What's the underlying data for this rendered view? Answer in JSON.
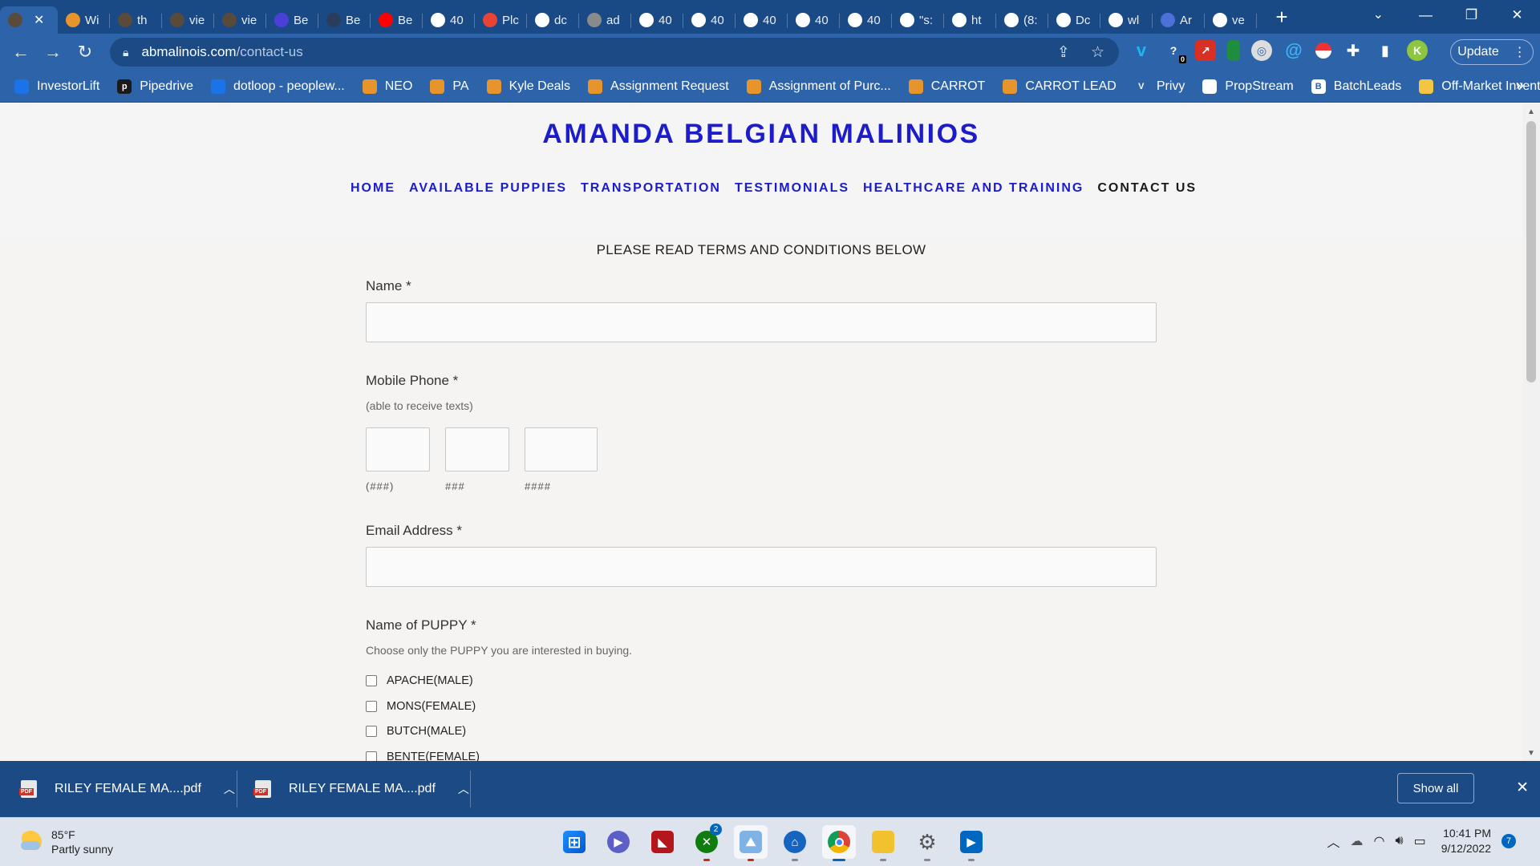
{
  "browser": {
    "tabs": [
      {
        "label": "",
        "favicon": "photo",
        "color": "#5a4a3a",
        "active": true
      },
      {
        "label": "Wi",
        "favicon": "pen-icon",
        "color": "#e8942c"
      },
      {
        "label": "th",
        "favicon": "photo",
        "color": "#5a4a3a"
      },
      {
        "label": "vie",
        "favicon": "photo",
        "color": "#5a4a3a"
      },
      {
        "label": "vie",
        "favicon": "photo",
        "color": "#5a4a3a"
      },
      {
        "label": "Be",
        "favicon": "g",
        "color": "#4c3fd8"
      },
      {
        "label": "Be",
        "favicon": "bird",
        "color": "#2a3d5a"
      },
      {
        "label": "Be",
        "favicon": "youtube",
        "color": "#ff0000"
      },
      {
        "label": "40",
        "favicon": "google",
        "color": "#ffffff"
      },
      {
        "label": "Plc",
        "favicon": "gmail",
        "color": "#ea4335"
      },
      {
        "label": "dc",
        "favicon": "dotloop",
        "color": "#ffffff"
      },
      {
        "label": "ad",
        "favicon": "globe",
        "color": "#8a8a8a"
      },
      {
        "label": "40",
        "favicon": "chatgpt",
        "color": "#ffffff"
      },
      {
        "label": "40",
        "favicon": "chatgpt",
        "color": "#ffffff"
      },
      {
        "label": "40",
        "favicon": "chatgpt",
        "color": "#ffffff"
      },
      {
        "label": "40",
        "favicon": "chatgpt",
        "color": "#ffffff"
      },
      {
        "label": "40",
        "favicon": "chatgpt",
        "color": "#ffffff"
      },
      {
        "label": "\"s:",
        "favicon": "google",
        "color": "#ffffff"
      },
      {
        "label": "ht",
        "favicon": "google",
        "color": "#ffffff"
      },
      {
        "label": "(8:",
        "favicon": "google",
        "color": "#ffffff"
      },
      {
        "label": "Dc",
        "favicon": "panda",
        "color": "#ffffff"
      },
      {
        "label": "wl",
        "favicon": "google",
        "color": "#ffffff"
      },
      {
        "label": "Ar",
        "favicon": "grid",
        "color": "#4c6fd8"
      },
      {
        "label": "ve",
        "favicon": "google",
        "color": "#ffffff"
      }
    ],
    "new_tab_label": "+",
    "url_host": "abmalinois.com",
    "url_path": "/contact-us",
    "update_label": "Update",
    "ext_badge": "0",
    "profile_initial": "K"
  },
  "bookmarks": [
    {
      "label": "InvestorLift",
      "color": "#1a73e8"
    },
    {
      "label": "Pipedrive",
      "color": "#1a1a1a",
      "glyph": "p"
    },
    {
      "label": "dotloop - peoplew...",
      "color": "#1a73e8"
    },
    {
      "label": "NEO",
      "color": "#e8942c"
    },
    {
      "label": "PA",
      "color": "#e8942c"
    },
    {
      "label": "Kyle Deals",
      "color": "#e8942c"
    },
    {
      "label": "Assignment Request",
      "color": "#e8942c"
    },
    {
      "label": "Assignment of Purc...",
      "color": "#e8942c"
    },
    {
      "label": "CARROT",
      "color": "#e8942c"
    },
    {
      "label": "CARROT LEAD",
      "color": "#e8942c"
    },
    {
      "label": "Privy",
      "color": "#2d63a8",
      "glyph": "V"
    },
    {
      "label": "PropStream",
      "color": "#ffffff"
    },
    {
      "label": "BatchLeads",
      "color": "#ffffff",
      "glyph": "B"
    },
    {
      "label": "Off-Market Inventory",
      "color": "#f4c542"
    }
  ],
  "bookmarks_more": "»",
  "site": {
    "title": "AMANDA BELGIAN MALINIOS",
    "nav": [
      "HOME",
      "AVAILABLE PUPPIES",
      "TRANSPORTATION",
      "TESTIMONIALS",
      "HEALTHCARE AND TRAINING",
      "CONTACT US"
    ],
    "current_nav": "CONTACT US"
  },
  "form": {
    "terms_notice": "PLEASE READ TERMS AND CONDITIONS BELOW",
    "name_label": "Name *",
    "name_value": "",
    "phone_label": "Mobile Phone *",
    "phone_hint": "(able to receive texts)",
    "phone_parts": [
      "(###)",
      "###",
      "####"
    ],
    "phone_values": [
      "",
      "",
      ""
    ],
    "email_label": "Email Address *",
    "email_value": "",
    "puppy_label": "Name of PUPPY *",
    "puppy_hint": "Choose only the PUPPY you are interested in buying.",
    "puppies": [
      {
        "label": "APACHE(MALE)",
        "checked": false
      },
      {
        "label": "MONS(FEMALE)",
        "checked": false
      },
      {
        "label": "BUTCH(MALE)",
        "checked": false
      },
      {
        "label": "BENTE(FEMALE)",
        "checked": false
      }
    ]
  },
  "downloads": {
    "items": [
      "RILEY FEMALE MA....pdf",
      "RILEY FEMALE MA....pdf"
    ],
    "show_all": "Show all"
  },
  "taskbar": {
    "temperature": "85°F",
    "condition": "Partly sunny",
    "time": "10:41 PM",
    "date": "9/12/2022",
    "notifications": "7",
    "xbox_badge": "2"
  }
}
